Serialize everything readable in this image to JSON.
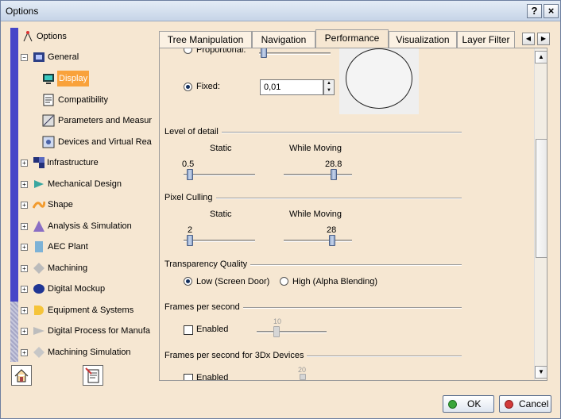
{
  "window": {
    "title": "Options",
    "help": "?",
    "close": "×"
  },
  "tree": {
    "items": [
      {
        "label": "Options"
      },
      {
        "label": "General"
      },
      {
        "label": "Display",
        "selected": true
      },
      {
        "label": "Compatibility"
      },
      {
        "label": "Parameters and Measur"
      },
      {
        "label": "Devices and Virtual Rea"
      },
      {
        "label": "Infrastructure"
      },
      {
        "label": "Mechanical Design"
      },
      {
        "label": "Shape"
      },
      {
        "label": "Analysis & Simulation"
      },
      {
        "label": "AEC Plant"
      },
      {
        "label": "Machining"
      },
      {
        "label": "Digital Mockup"
      },
      {
        "label": "Equipment & Systems"
      },
      {
        "label": "Digital Process for Manufa"
      },
      {
        "label": "Machining Simulation"
      }
    ]
  },
  "tabs": [
    {
      "label": "Tree Manipulation"
    },
    {
      "label": "Navigation"
    },
    {
      "label": "Performance",
      "active": true
    },
    {
      "label": "Visualization"
    },
    {
      "label": "Layer Filter"
    }
  ],
  "content": {
    "proportional_label": "Proportional:",
    "fixed_label": "Fixed:",
    "fixed_value": "0,01",
    "level_of_detail": {
      "title": "Level of detail",
      "static_label": "Static",
      "moving_label": "While Moving",
      "static_value": "0.5",
      "moving_value": "28.8"
    },
    "pixel_culling": {
      "title": "Pixel Culling",
      "static_label": "Static",
      "moving_label": "While Moving",
      "static_value": "2",
      "moving_value": "28"
    },
    "transparency": {
      "title": "Transparency Quality",
      "low_label": "Low (Screen Door)",
      "high_label": "High (Alpha Blending)"
    },
    "fps": {
      "title": "Frames per second",
      "enabled_label": "Enabled",
      "value": "10"
    },
    "fps_3dx": {
      "title": "Frames per second for 3Dx Devices",
      "enabled_label": "Enabled",
      "value": "20"
    }
  },
  "buttons": {
    "ok": "OK",
    "cancel": "Cancel"
  },
  "colors": {
    "selection": "#f9a23b",
    "tree_rail": "#4646c8",
    "ok_icon": "#3aa63a",
    "cancel_icon": "#d23a3a"
  }
}
